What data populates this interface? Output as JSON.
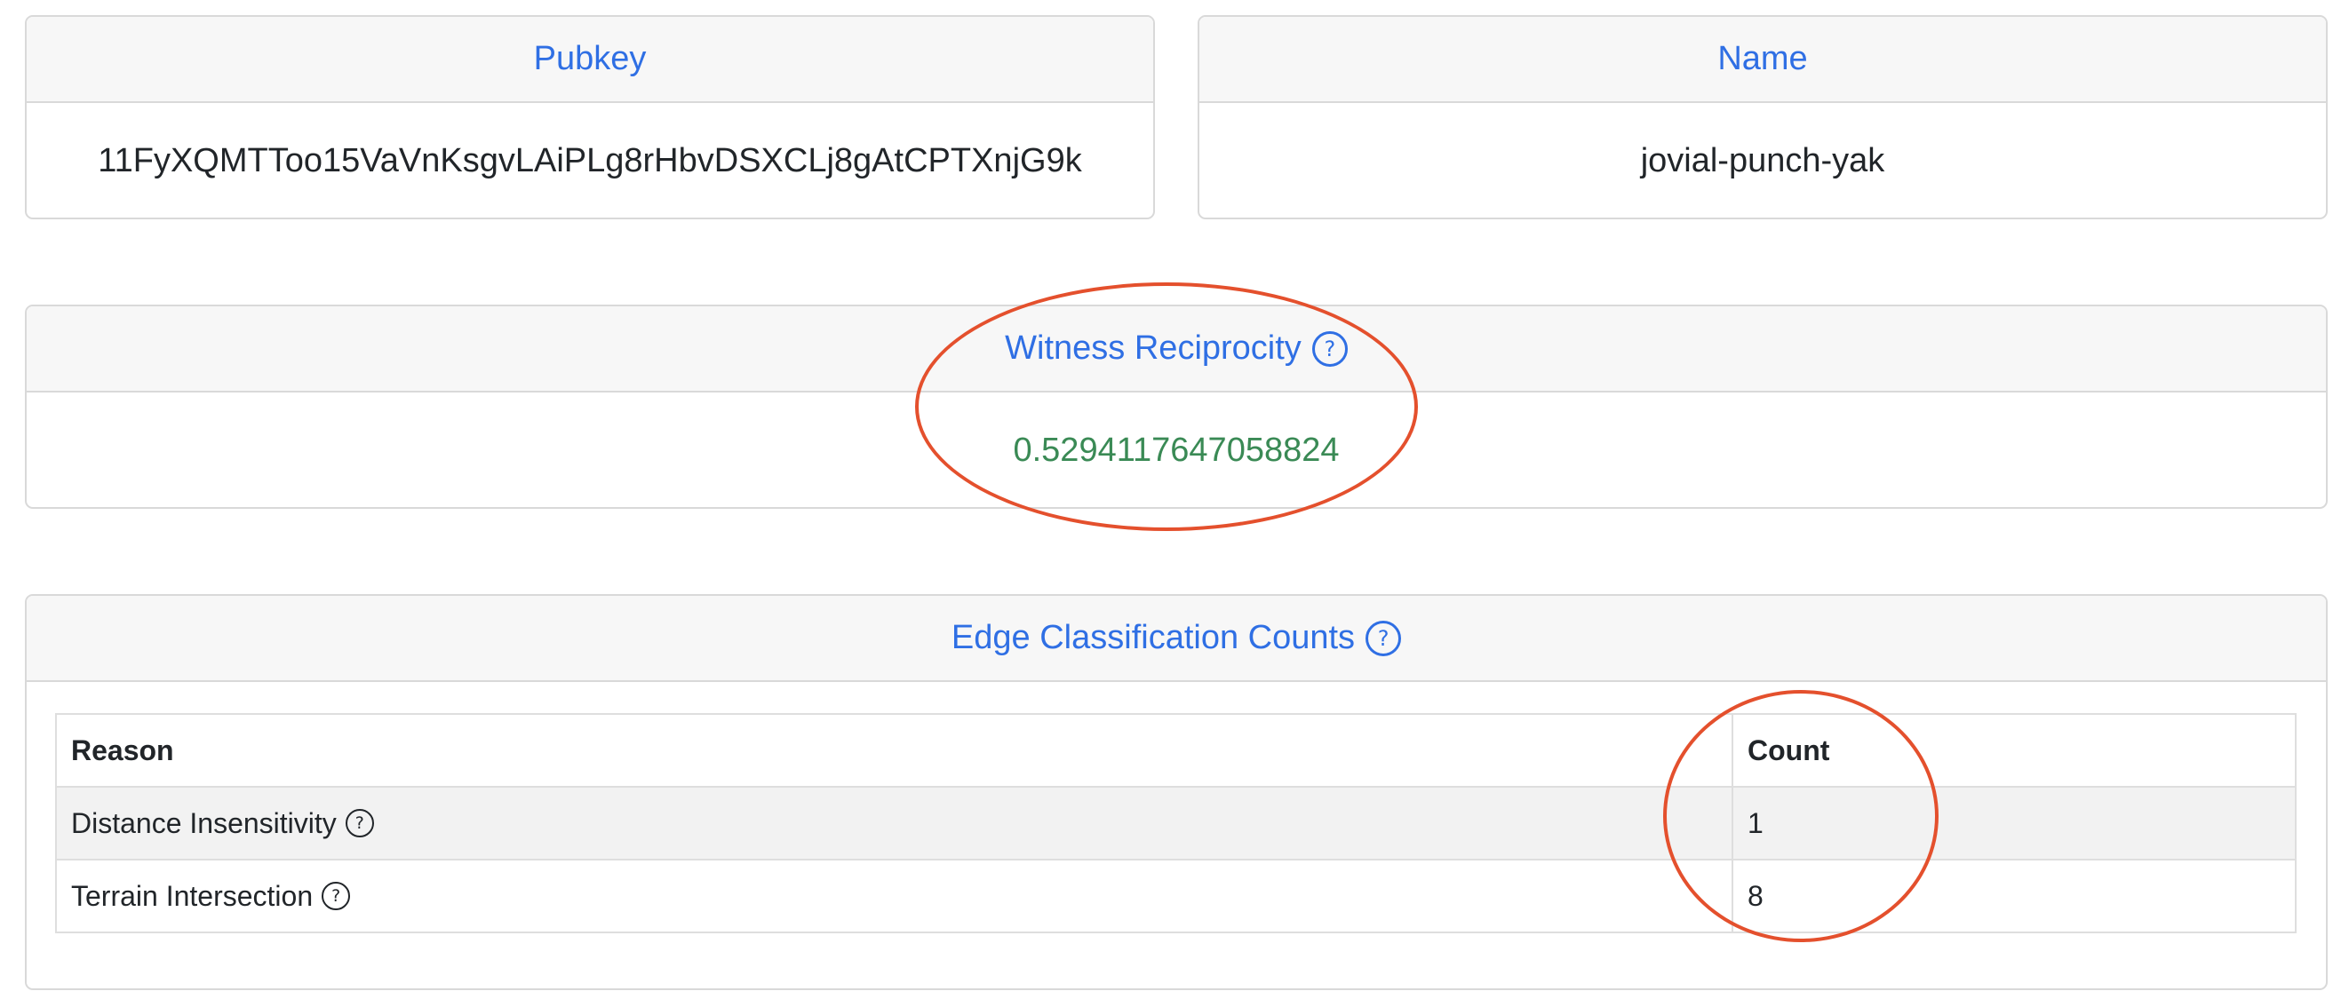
{
  "pubkey_card": {
    "header": "Pubkey",
    "value": "11FyXQMTToo15VaVnKsgvLAiPLg8rHbvDSXCLj8gAtCPTXnjG9k"
  },
  "name_card": {
    "header": "Name",
    "value": "jovial-punch-yak"
  },
  "reciprocity_card": {
    "header": "Witness Reciprocity",
    "help_icon": "?",
    "value": "0.5294117647058824"
  },
  "edge_card": {
    "header": "Edge Classification Counts",
    "help_icon": "?",
    "table": {
      "columns": [
        "Reason",
        "Count"
      ],
      "rows": [
        {
          "reason": "Distance Insensitivity",
          "help_icon": "?",
          "count": "1"
        },
        {
          "reason": "Terrain Intersection",
          "help_icon": "?",
          "count": "8"
        }
      ]
    }
  },
  "colors": {
    "accent_blue": "#2f6fe4",
    "value_green": "#3a8a55",
    "annotation_red": "#e4502d"
  },
  "icons": {
    "help": "question-circle-icon"
  }
}
